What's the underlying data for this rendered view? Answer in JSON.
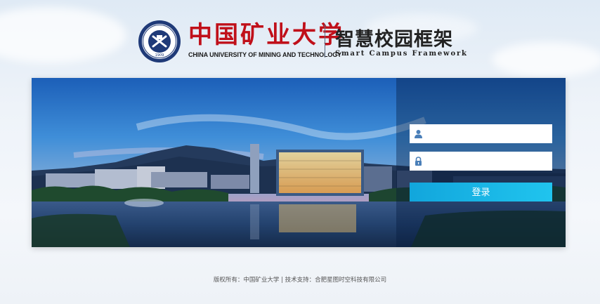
{
  "header": {
    "university_cn": "中国矿业大学",
    "university_en": "CHINA UNIVERSITY OF MINING AND TECHNOLOGY",
    "seal_year": "1909",
    "system_title": "智慧校园框架",
    "system_subtitle": "Smart Campus Framework"
  },
  "login": {
    "username": {
      "value": "",
      "placeholder": "",
      "icon": "user-icon"
    },
    "password": {
      "value": "",
      "placeholder": "",
      "icon": "lock-icon"
    },
    "submit_label": "登录"
  },
  "footer": {
    "text": "版权所有：中国矿业大学 | 技术支持：合肥星图时空科技有限公司"
  },
  "colors": {
    "brand_red": "#c0101a",
    "button": "#1cb8e8"
  }
}
